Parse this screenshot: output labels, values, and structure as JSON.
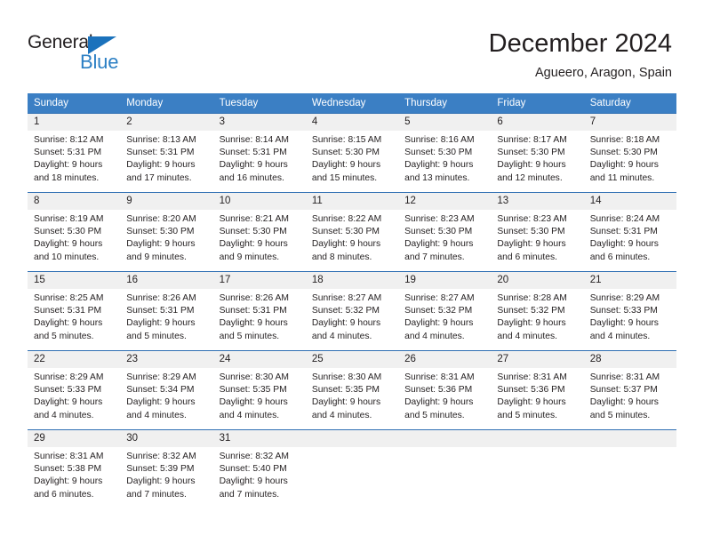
{
  "brand": {
    "name_part1": "General",
    "name_part2": "Blue",
    "triangle_color": "#1b72bc",
    "blue_text_color": "#2b7fc4"
  },
  "header": {
    "title": "December 2024",
    "subtitle": "Agueero, Aragon, Spain"
  },
  "calendar": {
    "header_bg": "#3b7fc4",
    "row_line_color": "#2f6fb3",
    "day_strip_bg": "#f0f0f0",
    "weekdays": [
      "Sunday",
      "Monday",
      "Tuesday",
      "Wednesday",
      "Thursday",
      "Friday",
      "Saturday"
    ],
    "weeks": [
      [
        {
          "day": "1",
          "lines": [
            "Sunrise: 8:12 AM",
            "Sunset: 5:31 PM",
            "Daylight: 9 hours",
            "and 18 minutes."
          ]
        },
        {
          "day": "2",
          "lines": [
            "Sunrise: 8:13 AM",
            "Sunset: 5:31 PM",
            "Daylight: 9 hours",
            "and 17 minutes."
          ]
        },
        {
          "day": "3",
          "lines": [
            "Sunrise: 8:14 AM",
            "Sunset: 5:31 PM",
            "Daylight: 9 hours",
            "and 16 minutes."
          ]
        },
        {
          "day": "4",
          "lines": [
            "Sunrise: 8:15 AM",
            "Sunset: 5:30 PM",
            "Daylight: 9 hours",
            "and 15 minutes."
          ]
        },
        {
          "day": "5",
          "lines": [
            "Sunrise: 8:16 AM",
            "Sunset: 5:30 PM",
            "Daylight: 9 hours",
            "and 13 minutes."
          ]
        },
        {
          "day": "6",
          "lines": [
            "Sunrise: 8:17 AM",
            "Sunset: 5:30 PM",
            "Daylight: 9 hours",
            "and 12 minutes."
          ]
        },
        {
          "day": "7",
          "lines": [
            "Sunrise: 8:18 AM",
            "Sunset: 5:30 PM",
            "Daylight: 9 hours",
            "and 11 minutes."
          ]
        }
      ],
      [
        {
          "day": "8",
          "lines": [
            "Sunrise: 8:19 AM",
            "Sunset: 5:30 PM",
            "Daylight: 9 hours",
            "and 10 minutes."
          ]
        },
        {
          "day": "9",
          "lines": [
            "Sunrise: 8:20 AM",
            "Sunset: 5:30 PM",
            "Daylight: 9 hours",
            "and 9 minutes."
          ]
        },
        {
          "day": "10",
          "lines": [
            "Sunrise: 8:21 AM",
            "Sunset: 5:30 PM",
            "Daylight: 9 hours",
            "and 9 minutes."
          ]
        },
        {
          "day": "11",
          "lines": [
            "Sunrise: 8:22 AM",
            "Sunset: 5:30 PM",
            "Daylight: 9 hours",
            "and 8 minutes."
          ]
        },
        {
          "day": "12",
          "lines": [
            "Sunrise: 8:23 AM",
            "Sunset: 5:30 PM",
            "Daylight: 9 hours",
            "and 7 minutes."
          ]
        },
        {
          "day": "13",
          "lines": [
            "Sunrise: 8:23 AM",
            "Sunset: 5:30 PM",
            "Daylight: 9 hours",
            "and 6 minutes."
          ]
        },
        {
          "day": "14",
          "lines": [
            "Sunrise: 8:24 AM",
            "Sunset: 5:31 PM",
            "Daylight: 9 hours",
            "and 6 minutes."
          ]
        }
      ],
      [
        {
          "day": "15",
          "lines": [
            "Sunrise: 8:25 AM",
            "Sunset: 5:31 PM",
            "Daylight: 9 hours",
            "and 5 minutes."
          ]
        },
        {
          "day": "16",
          "lines": [
            "Sunrise: 8:26 AM",
            "Sunset: 5:31 PM",
            "Daylight: 9 hours",
            "and 5 minutes."
          ]
        },
        {
          "day": "17",
          "lines": [
            "Sunrise: 8:26 AM",
            "Sunset: 5:31 PM",
            "Daylight: 9 hours",
            "and 5 minutes."
          ]
        },
        {
          "day": "18",
          "lines": [
            "Sunrise: 8:27 AM",
            "Sunset: 5:32 PM",
            "Daylight: 9 hours",
            "and 4 minutes."
          ]
        },
        {
          "day": "19",
          "lines": [
            "Sunrise: 8:27 AM",
            "Sunset: 5:32 PM",
            "Daylight: 9 hours",
            "and 4 minutes."
          ]
        },
        {
          "day": "20",
          "lines": [
            "Sunrise: 8:28 AM",
            "Sunset: 5:32 PM",
            "Daylight: 9 hours",
            "and 4 minutes."
          ]
        },
        {
          "day": "21",
          "lines": [
            "Sunrise: 8:29 AM",
            "Sunset: 5:33 PM",
            "Daylight: 9 hours",
            "and 4 minutes."
          ]
        }
      ],
      [
        {
          "day": "22",
          "lines": [
            "Sunrise: 8:29 AM",
            "Sunset: 5:33 PM",
            "Daylight: 9 hours",
            "and 4 minutes."
          ]
        },
        {
          "day": "23",
          "lines": [
            "Sunrise: 8:29 AM",
            "Sunset: 5:34 PM",
            "Daylight: 9 hours",
            "and 4 minutes."
          ]
        },
        {
          "day": "24",
          "lines": [
            "Sunrise: 8:30 AM",
            "Sunset: 5:35 PM",
            "Daylight: 9 hours",
            "and 4 minutes."
          ]
        },
        {
          "day": "25",
          "lines": [
            "Sunrise: 8:30 AM",
            "Sunset: 5:35 PM",
            "Daylight: 9 hours",
            "and 4 minutes."
          ]
        },
        {
          "day": "26",
          "lines": [
            "Sunrise: 8:31 AM",
            "Sunset: 5:36 PM",
            "Daylight: 9 hours",
            "and 5 minutes."
          ]
        },
        {
          "day": "27",
          "lines": [
            "Sunrise: 8:31 AM",
            "Sunset: 5:36 PM",
            "Daylight: 9 hours",
            "and 5 minutes."
          ]
        },
        {
          "day": "28",
          "lines": [
            "Sunrise: 8:31 AM",
            "Sunset: 5:37 PM",
            "Daylight: 9 hours",
            "and 5 minutes."
          ]
        }
      ],
      [
        {
          "day": "29",
          "lines": [
            "Sunrise: 8:31 AM",
            "Sunset: 5:38 PM",
            "Daylight: 9 hours",
            "and 6 minutes."
          ]
        },
        {
          "day": "30",
          "lines": [
            "Sunrise: 8:32 AM",
            "Sunset: 5:39 PM",
            "Daylight: 9 hours",
            "and 7 minutes."
          ]
        },
        {
          "day": "31",
          "lines": [
            "Sunrise: 8:32 AM",
            "Sunset: 5:40 PM",
            "Daylight: 9 hours",
            "and 7 minutes."
          ]
        },
        {
          "day": "",
          "lines": []
        },
        {
          "day": "",
          "lines": []
        },
        {
          "day": "",
          "lines": []
        },
        {
          "day": "",
          "lines": []
        }
      ]
    ]
  }
}
